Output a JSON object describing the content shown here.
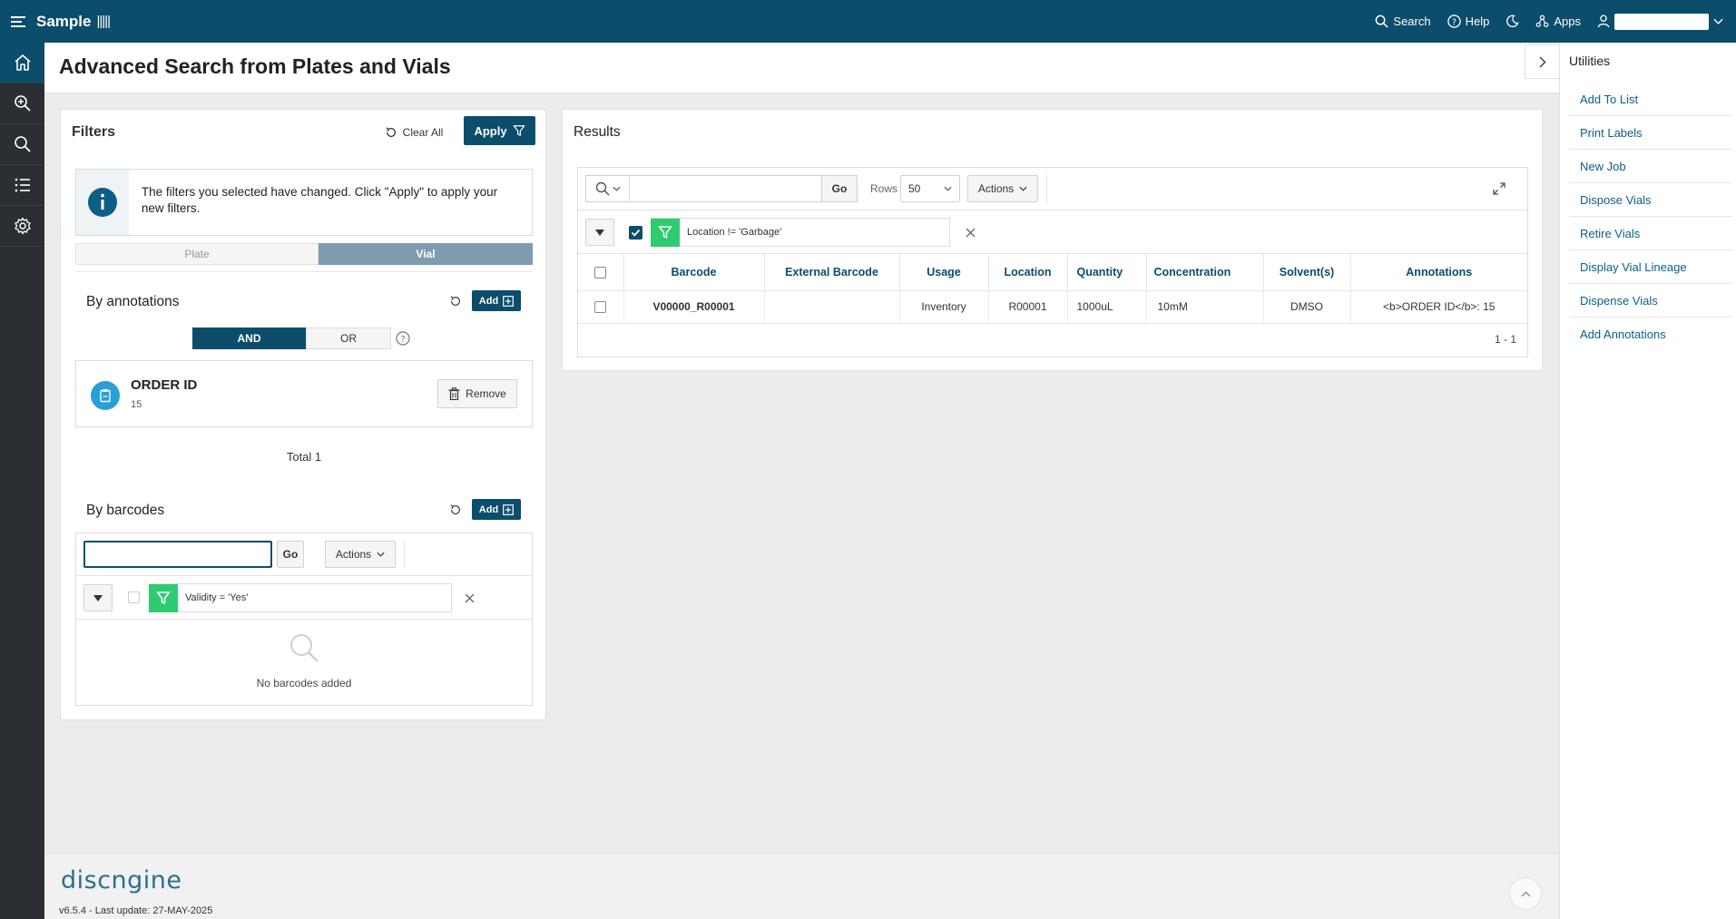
{
  "topbar": {
    "app_name": "Sample",
    "bars_glyph": "|||||",
    "search_label": "Search",
    "help_label": "Help",
    "apps_label": "Apps"
  },
  "sidenav": {
    "items": [
      "home-icon",
      "zoom-search-icon",
      "search-icon",
      "list-icon",
      "gear-icon"
    ]
  },
  "page": {
    "title": "Advanced Search from Plates and Vials"
  },
  "filters": {
    "title": "Filters",
    "clear_all": "Clear All",
    "apply": "Apply",
    "info_message": "The filters you selected have changed. Click \"Apply\" to apply your new filters.",
    "tabs": [
      "Plate",
      "Vial"
    ],
    "active_tab": "Vial",
    "annotations": {
      "title": "By annotations",
      "add_label": "Add",
      "logic": [
        "AND",
        "OR"
      ],
      "active_logic": "AND",
      "item": {
        "name": "ORDER ID",
        "value": "15",
        "remove_label": "Remove"
      },
      "total": "Total 1"
    },
    "barcodes": {
      "title": "By barcodes",
      "add_label": "Add",
      "input_value": "",
      "go_label": "Go",
      "actions_label": "Actions",
      "filter_text": "Validity = 'Yes'",
      "empty_text": "No barcodes added"
    }
  },
  "results": {
    "title": "Results",
    "search_value": "",
    "go_label": "Go",
    "rows_label": "Rows",
    "rows_value": "50",
    "actions_label": "Actions",
    "filter_text": "Location != 'Garbage'",
    "columns": [
      "Barcode",
      "External Barcode",
      "Usage",
      "Location",
      "Quantity",
      "Concentration",
      "Solvent(s)",
      "Annotations"
    ],
    "rows": [
      {
        "barcode": "V00000_R00001",
        "external_barcode": "",
        "usage": "Inventory",
        "location": "R00001",
        "quantity": "1000uL",
        "concentration": "10mM",
        "solvent": "DMSO",
        "annotations": "<b>ORDER ID</b>: 15"
      }
    ],
    "pagination": "1 - 1"
  },
  "utilities": {
    "title": "Utilities",
    "items": [
      "Add To List",
      "Print Labels",
      "New Job",
      "Dispose Vials",
      "Retire Vials",
      "Display Vial Lineage",
      "Dispense Vials",
      "Add Annotations"
    ]
  },
  "footer": {
    "logo": "discngine",
    "version": "v6.5.4 - Last update: 27-MAY-2025"
  },
  "colors": {
    "primary": "#0b4d6b",
    "accent_green": "#2ecc71",
    "link": "#0b5f86",
    "info_blue": "#2a9fd6"
  }
}
